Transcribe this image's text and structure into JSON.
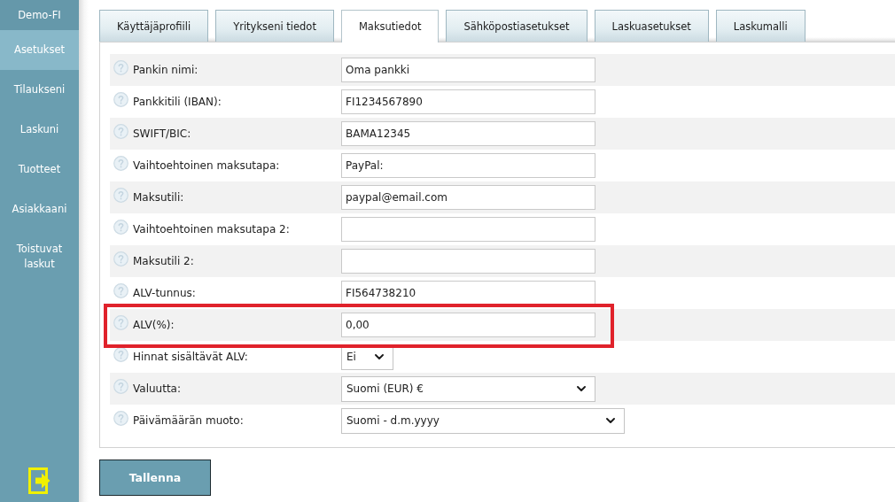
{
  "sidebar": {
    "header": "Demo-FI",
    "items": [
      {
        "label": "Asetukset",
        "selected": true
      },
      {
        "label": "Tilaukseni",
        "selected": false
      },
      {
        "label": "Laskuni",
        "selected": false
      },
      {
        "label": "Tuotteet",
        "selected": false
      },
      {
        "label": "Asiakkaani",
        "selected": false
      },
      {
        "label": "Toistuvat laskut",
        "selected": false
      }
    ]
  },
  "tabs": [
    {
      "label": "Käyttäjäprofiili",
      "selected": false
    },
    {
      "label": "Yritykseni tiedot",
      "selected": false
    },
    {
      "label": "Maksutiedot",
      "selected": true
    },
    {
      "label": "Sähköpostiasetukset",
      "selected": false
    },
    {
      "label": "Laskuasetukset",
      "selected": false
    },
    {
      "label": "Laskumalli",
      "selected": false
    }
  ],
  "form": {
    "rows": [
      {
        "label": "Pankin nimi:",
        "kind": "text",
        "value": "Oma pankki",
        "highlighted": false
      },
      {
        "label": "Pankkitili (IBAN):",
        "kind": "text",
        "value": "FI1234567890",
        "highlighted": false
      },
      {
        "label": "SWIFT/BIC:",
        "kind": "text",
        "value": "BAMA12345",
        "highlighted": false
      },
      {
        "label": "Vaihtoehtoinen maksutapa:",
        "kind": "text",
        "value": "PayPal:",
        "highlighted": false
      },
      {
        "label": "Maksutili:",
        "kind": "text",
        "value": "paypal@email.com",
        "highlighted": false
      },
      {
        "label": "Vaihtoehtoinen maksutapa 2:",
        "kind": "text",
        "highlighted": false
      },
      {
        "label": "Maksutili 2:",
        "kind": "text",
        "highlighted": false
      },
      {
        "label": "ALV-tunnus:",
        "kind": "text",
        "value": "FI564738210",
        "highlighted": false
      },
      {
        "label": "ALV(%):",
        "kind": "text",
        "value": "0,00",
        "highlighted": true
      },
      {
        "label": "Hinnat sisältävät ALV:",
        "kind": "select",
        "value": "Ei",
        "highlighted": false
      },
      {
        "label": "Valuutta:",
        "kind": "select",
        "value": "Suomi (EUR) €",
        "highlighted": false
      },
      {
        "label": "Päivämäärän muoto:",
        "kind": "select",
        "value": "Suomi - d.m.yyyy",
        "highlighted": false
      }
    ]
  },
  "save_button": "Tallenna"
}
